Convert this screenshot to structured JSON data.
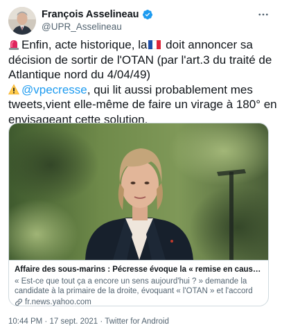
{
  "author": {
    "name": "François Asselineau",
    "handle": "@UPR_Asselineau",
    "verified": true
  },
  "tweet": {
    "line1": "Enfin, acte historique, la",
    "line1_after_flag": " doit annoncer sa",
    "line2": "décision de sortir de l'OTAN (par l'art.3 du traité de",
    "line3": "Atlantique nord du 4/04/49)",
    "mention": "@vpecresse",
    "line4_after_mention": ", qui lit aussi probablement mes",
    "line5": "tweets,vient elle-même de faire un virage à 180° en",
    "line6": "envisageant cette solution.",
    "emojis": [
      "rotating-light-icon",
      "france-flag-icon",
      "warning-icon"
    ]
  },
  "card": {
    "title": "Affaire des sous-marins : Pécresse évoque la « remise en cause » de nos alliances",
    "description": "« Est-ce que tout ça a encore un sens aujourd'hui ? » demande la candidate à la primaire de la droite, évoquant « l'OTAN » et l'accord militaire de « Lancaster House » avec le Royaume-Uni",
    "domain": "fr.news.yahoo.com"
  },
  "footer": {
    "time": "10:44 PM",
    "separator1": " · ",
    "date": "17 sept. 2021",
    "separator2": " · ",
    "source": "Twitter for Android"
  },
  "colors": {
    "accent": "#1d9bf0",
    "text": "#0f1419",
    "secondary": "#536471",
    "border": "#cfd9de"
  }
}
